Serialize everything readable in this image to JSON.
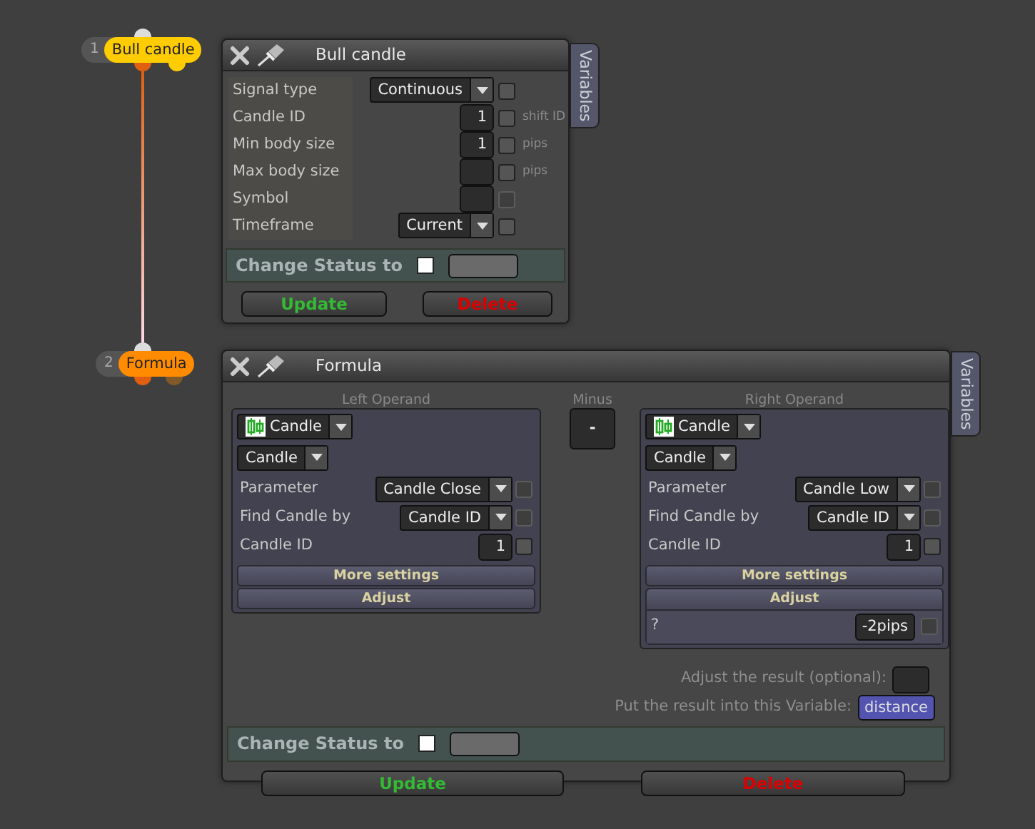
{
  "canvas_nodes": [
    {
      "number": "1",
      "label": "Bull candle",
      "color": "#ffcc00"
    },
    {
      "number": "2",
      "label": "Formula",
      "color": "#ff8c00"
    }
  ],
  "signal_panel": {
    "title": "Bull candle",
    "side_tab": "Variables",
    "fields": [
      {
        "label": "Signal type",
        "kind": "select",
        "value": "Continuous",
        "checked": false,
        "disabled": false
      },
      {
        "label": "Candle ID",
        "kind": "input",
        "value": "1",
        "checked": false,
        "disabled": false,
        "unit": "shift ID"
      },
      {
        "label": "Min body size",
        "kind": "input",
        "value": "1",
        "checked": false,
        "disabled": false,
        "unit": "pips"
      },
      {
        "label": "Max body size",
        "kind": "input",
        "checked": false,
        "disabled": false,
        "unit": "pips"
      },
      {
        "label": "Symbol",
        "kind": "input",
        "checked": false,
        "disabled": true
      },
      {
        "label": "Timeframe",
        "kind": "select",
        "value": "Current",
        "checked": false,
        "disabled": false
      }
    ],
    "status": {
      "label": "Change Status to",
      "checked": false
    },
    "buttons": [
      {
        "label": "Update",
        "kind": "update"
      },
      {
        "label": "Delete",
        "kind": "delete"
      }
    ]
  },
  "formula_panel": {
    "title": "Formula",
    "side_tab": "Variables",
    "left_operand": {
      "caption": "Left Operand",
      "source": "Candle",
      "type": "Candle",
      "fields": [
        {
          "label": "Parameter",
          "kind": "select",
          "value": "Candle Close",
          "checked": false,
          "disabled": true
        },
        {
          "label": "Find Candle by",
          "kind": "select",
          "value": "Candle ID",
          "checked": false,
          "disabled": true
        },
        {
          "label": "Candle ID",
          "kind": "input",
          "value": "1",
          "checked": false,
          "disabled": false
        }
      ],
      "more_settings": "More settings",
      "adjust": {
        "label": "Adjust",
        "expanded": false
      }
    },
    "operator": {
      "caption": "Minus",
      "value": "-"
    },
    "right_operand": {
      "caption": "Right Operand",
      "source": "Candle",
      "type": "Candle",
      "fields": [
        {
          "label": "Parameter",
          "kind": "select",
          "value": "Candle Low",
          "checked": false,
          "disabled": true
        },
        {
          "label": "Find Candle by",
          "kind": "select",
          "value": "Candle ID",
          "checked": false,
          "disabled": true
        },
        {
          "label": "Candle ID",
          "kind": "input",
          "value": "1",
          "checked": false,
          "disabled": false
        }
      ],
      "more_settings": "More settings",
      "adjust": {
        "label": "Adjust",
        "expanded": true,
        "rows": [
          {
            "label": "?",
            "value": "-2pips",
            "checked": false,
            "disabled": true
          }
        ]
      }
    },
    "adjust_label": "Adjust the result (optional):",
    "variable_label": "Put the result into this Variable:",
    "variable": "distance",
    "status": {
      "label": "Change Status to",
      "checked": false
    },
    "buttons": [
      {
        "label": "Update",
        "kind": "update"
      },
      {
        "label": "Delete",
        "kind": "delete"
      }
    ]
  }
}
